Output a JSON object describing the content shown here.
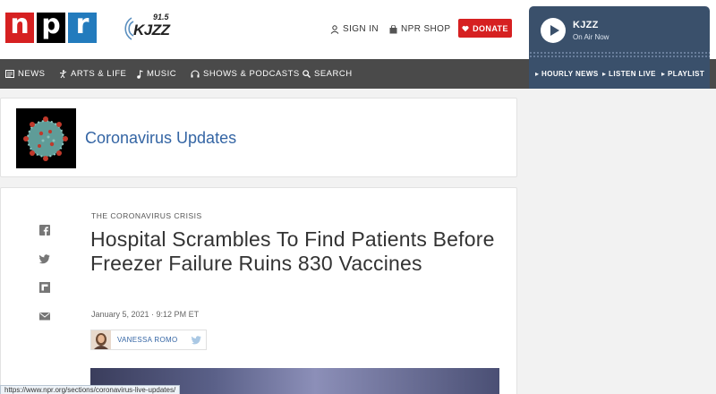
{
  "header": {
    "npr_letters": [
      "n",
      "p",
      "r"
    ],
    "kjzz_frequency": "91.5",
    "kjzz_call": "KJZZ",
    "sign_in": "SIGN IN",
    "shop": "NPR SHOP",
    "donate": "DONATE"
  },
  "player": {
    "station": "KJZZ",
    "status": "On Air Now"
  },
  "nav": {
    "items": [
      "NEWS",
      "ARTS & LIFE",
      "MUSIC",
      "SHOWS & PODCASTS",
      "SEARCH"
    ],
    "right_items": [
      "HOURLY NEWS",
      "LISTEN LIVE",
      "PLAYLIST"
    ]
  },
  "corona": {
    "title": "Coronavirus Updates"
  },
  "article": {
    "slug": "THE CORONAVIRUS CRISIS",
    "headline": "Hospital Scrambles To Find Patients Before Freezer Failure Ruins 830 Vaccines",
    "date": "January 5, 2021 · 9:12 PM ET",
    "author": "VANESSA ROMO"
  },
  "status_bar": {
    "url": "https://www.npr.org/sections/coronavirus-live-updates/"
  },
  "colors": {
    "npr_red": "#d62021",
    "npr_blue": "#237bbd",
    "player_bg": "#3a506b",
    "nav_bg": "#4a4a4a",
    "link_blue": "#3465a4"
  }
}
